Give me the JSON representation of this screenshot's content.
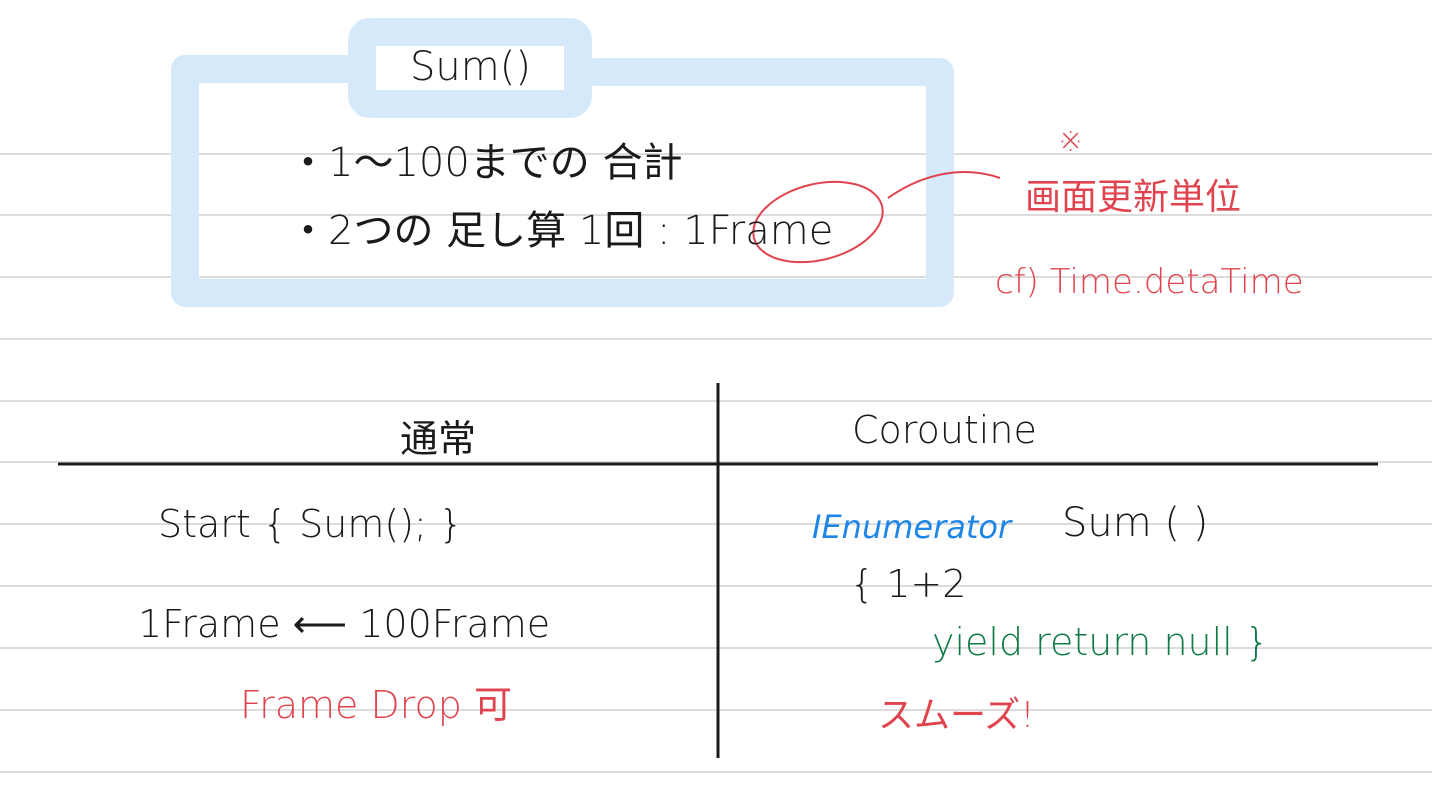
{
  "colors": {
    "ink": "#1a1a1a",
    "red": "#e0454f",
    "blue": "#1f86e6",
    "green": "#0f7a47",
    "frame": "#d6e9fb",
    "rule": "#dcdcdc"
  },
  "box": {
    "title": "Sum()",
    "bullet1": "・1～100までの 合計",
    "bullet2": "・2つの 足し算 1回 : 1Frame"
  },
  "note": {
    "mark": "※",
    "line1": "画面更新単位",
    "line2": "cf) Time.detaTime"
  },
  "table": {
    "left_header": "通常",
    "right_header": "Coroutine",
    "left": {
      "line1": "Start { Sum(); }",
      "line2": "1Frame ⟵ 100Frame",
      "line3": "Frame Drop 可"
    },
    "right": {
      "line1_type": "IEnumerator",
      "line1_name": "Sum ( )",
      "line2": "{   1+2",
      "line3": "yield return null }",
      "line4": "スムーズ!"
    }
  }
}
